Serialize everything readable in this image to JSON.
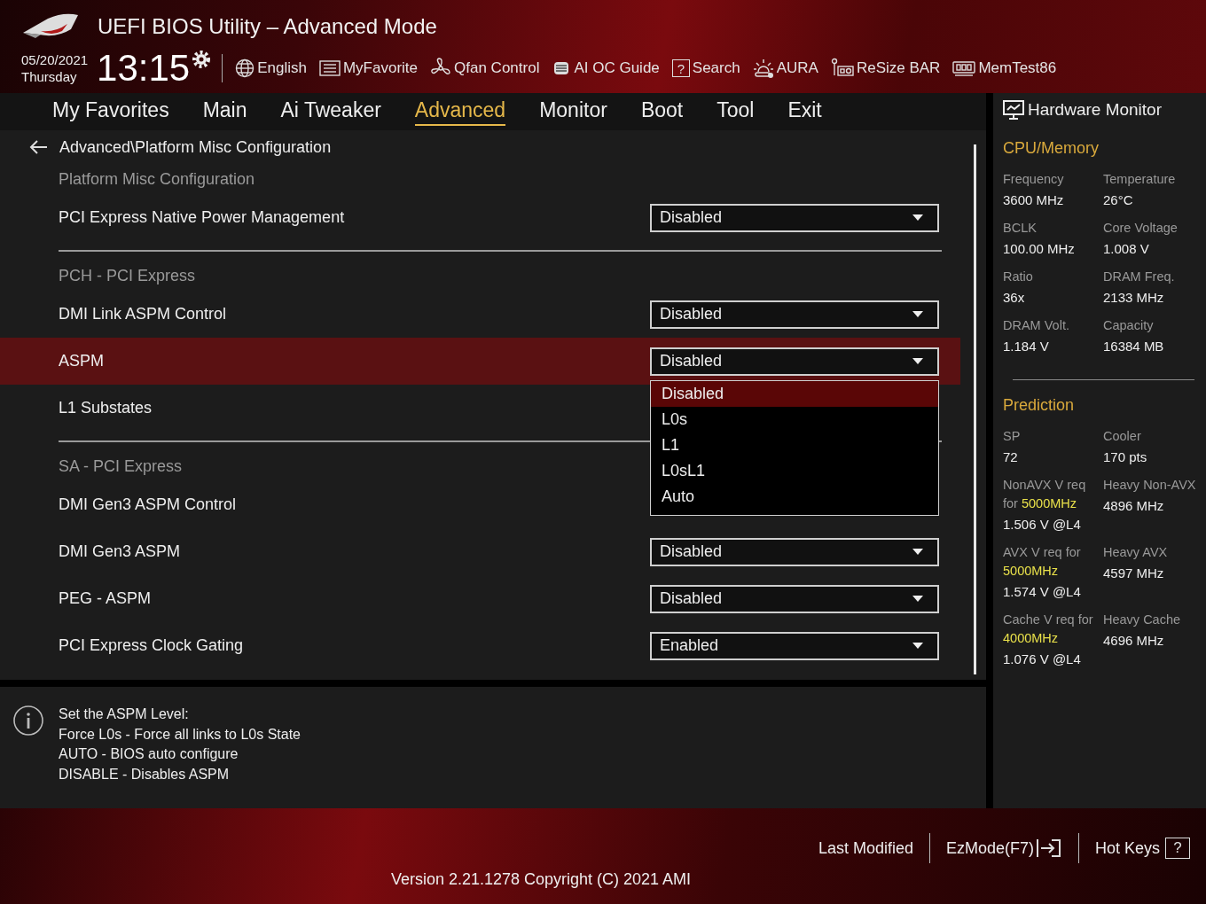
{
  "header": {
    "title": "UEFI BIOS Utility – Advanced Mode",
    "date": "05/20/2021",
    "day": "Thursday",
    "time": "13:15",
    "tools": [
      {
        "kind": "globe",
        "label": "English"
      },
      {
        "kind": "list",
        "label": "MyFavorite"
      },
      {
        "kind": "fan",
        "label": "Qfan Control"
      },
      {
        "kind": "chip",
        "label": "AI OC Guide"
      },
      {
        "kind": "help",
        "icon_text": "?",
        "label": "Search"
      },
      {
        "kind": "sun",
        "label": "AURA"
      },
      {
        "kind": "card",
        "label": "ReSize BAR"
      },
      {
        "kind": "memory",
        "label": "MemTest86"
      }
    ]
  },
  "tabs": [
    {
      "label": "My Favorites",
      "selected": false
    },
    {
      "label": "Main",
      "selected": false
    },
    {
      "label": "Ai Tweaker",
      "selected": false
    },
    {
      "label": "Advanced",
      "selected": true
    },
    {
      "label": "Monitor",
      "selected": false
    },
    {
      "label": "Boot",
      "selected": false
    },
    {
      "label": "Tool",
      "selected": false
    },
    {
      "label": "Exit",
      "selected": false
    }
  ],
  "breadcrumb": "Advanced\\Platform Misc Configuration",
  "rows": [
    {
      "kind": "heading",
      "label": "Platform Misc Configuration"
    },
    {
      "kind": "setting",
      "label": "PCI Express Native Power Management",
      "value": "Disabled",
      "selected": false
    },
    {
      "kind": "divider"
    },
    {
      "kind": "heading",
      "label": "PCH - PCI Express"
    },
    {
      "kind": "setting",
      "label": "DMI Link ASPM Control",
      "value": "Disabled",
      "selected": false
    },
    {
      "kind": "setting",
      "label": "ASPM",
      "value": "Disabled",
      "selected": true,
      "options": [
        {
          "label": "Disabled",
          "selected": true
        },
        {
          "label": "L0s",
          "selected": false
        },
        {
          "label": "L1",
          "selected": false
        },
        {
          "label": "L0sL1",
          "selected": false
        },
        {
          "label": "Auto",
          "selected": false
        }
      ]
    },
    {
      "kind": "setting",
      "label": "L1 Substates",
      "selected": false
    },
    {
      "kind": "divider"
    },
    {
      "kind": "heading",
      "label": "SA - PCI Express"
    },
    {
      "kind": "setting",
      "label": "DMI Gen3 ASPM Control",
      "selected": false
    },
    {
      "kind": "setting",
      "label": "DMI Gen3 ASPM",
      "value": "Disabled",
      "selected": false
    },
    {
      "kind": "setting",
      "label": "PEG - ASPM",
      "value": "Disabled",
      "selected": false
    },
    {
      "kind": "setting",
      "label": "PCI Express Clock Gating",
      "value": "Enabled",
      "selected": false
    }
  ],
  "help": {
    "lines": [
      "Set the ASPM Level:",
      "Force L0s - Force all links to L0s State",
      "AUTO - BIOS auto configure",
      "DISABLE - Disables ASPM"
    ]
  },
  "hardware_monitor": {
    "title": "Hardware Monitor",
    "sections": [
      {
        "title": "CPU/Memory",
        "blocks": [
          {
            "left": [
              {
                "kind": "label",
                "text": "Frequency"
              },
              {
                "kind": "value",
                "text": "3600 MHz"
              }
            ],
            "right": [
              {
                "kind": "label",
                "text": "Temperature"
              },
              {
                "kind": "value",
                "text": "26°C"
              }
            ]
          },
          {
            "left": [
              {
                "kind": "label",
                "text": "BCLK"
              },
              {
                "kind": "value",
                "text": "100.00 MHz"
              }
            ],
            "right": [
              {
                "kind": "label",
                "text": "Core Voltage"
              },
              {
                "kind": "value",
                "text": "1.008 V"
              }
            ]
          },
          {
            "left": [
              {
                "kind": "label",
                "text": "Ratio"
              },
              {
                "kind": "value",
                "text": "36x"
              }
            ],
            "right": [
              {
                "kind": "label",
                "text": "DRAM Freq."
              },
              {
                "kind": "value",
                "text": "2133 MHz"
              }
            ]
          },
          {
            "left": [
              {
                "kind": "label",
                "text": "DRAM Volt."
              },
              {
                "kind": "value",
                "text": "1.184 V"
              }
            ],
            "right": [
              {
                "kind": "label",
                "text": "Capacity"
              },
              {
                "kind": "value",
                "text": "16384 MB"
              }
            ]
          }
        ]
      },
      {
        "title": "Prediction",
        "blocks": [
          {
            "left": [
              {
                "kind": "label",
                "text": "SP"
              },
              {
                "kind": "value",
                "text": "72"
              }
            ],
            "right": [
              {
                "kind": "label",
                "text": "Cooler"
              },
              {
                "kind": "value",
                "text": "170 pts"
              }
            ]
          },
          {
            "left": [
              {
                "kind": "label",
                "text": "NonAVX V req for **5000MHz**"
              },
              {
                "kind": "value",
                "text": "1.506 V @L4"
              }
            ],
            "right": [
              {
                "kind": "label",
                "text": "Heavy Non-AVX"
              },
              {
                "kind": "value",
                "text": "4896 MHz"
              }
            ]
          },
          {
            "left": [
              {
                "kind": "label",
                "text": "AVX V req   for **5000MHz**"
              },
              {
                "kind": "value",
                "text": "1.574 V @L4"
              }
            ],
            "right": [
              {
                "kind": "label",
                "text": "Heavy AVX"
              },
              {
                "kind": "value",
                "text": "4597 MHz"
              }
            ]
          },
          {
            "left": [
              {
                "kind": "label",
                "text": "Cache V req for **4000MHz**"
              },
              {
                "kind": "value",
                "text": "1.076 V @L4"
              }
            ],
            "right": [
              {
                "kind": "label",
                "text": "Heavy Cache"
              },
              {
                "kind": "value",
                "text": "4696 MHz"
              }
            ]
          }
        ]
      }
    ]
  },
  "footer": {
    "last_modified": "Last Modified",
    "ezmode": "EzMode(F7)",
    "hotkeys": "Hot Keys",
    "hotkeys_icon_text": "?",
    "version": "Version 2.21.1278 Copyright (C) 2021 AMI"
  }
}
